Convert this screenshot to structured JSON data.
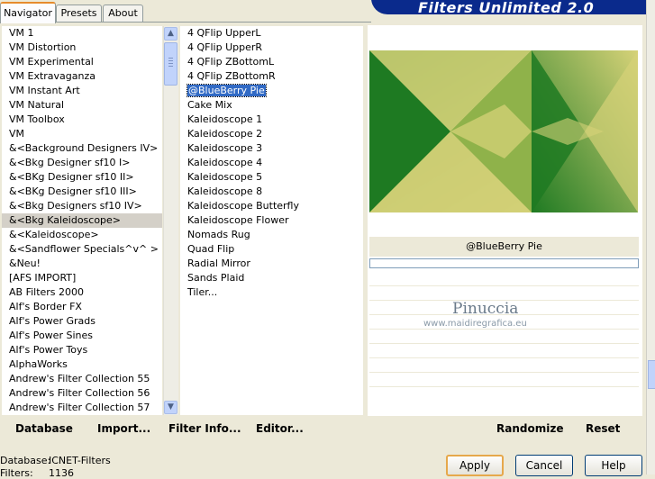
{
  "tabs": [
    {
      "label": "Navigator",
      "active": true
    },
    {
      "label": "Presets",
      "active": false
    },
    {
      "label": "About",
      "active": false
    }
  ],
  "banner": {
    "title": "Filters Unlimited 2.0"
  },
  "categories": {
    "selected_index": 13,
    "items": [
      "VM 1",
      "VM Distortion",
      "VM Experimental",
      "VM Extravaganza",
      "VM Instant Art",
      "VM Natural",
      "VM Toolbox",
      "VM",
      "&<Background Designers IV>",
      "&<Bkg Designer sf10 I>",
      "&<BKg Designer sf10 II>",
      "&<BKg Designer sf10 III>",
      "&<Bkg Designers sf10 IV>",
      "&<Bkg Kaleidoscope>",
      "&<Kaleidoscope>",
      "&<Sandflower Specials^v^ >",
      "&Neu!",
      "[AFS IMPORT]",
      "AB Filters 2000",
      "Alf's Border FX",
      "Alf's Power Grads",
      "Alf's Power Sines",
      "Alf's Power Toys",
      "AlphaWorks",
      "Andrew's Filter Collection 55",
      "Andrew's Filter Collection 56",
      "Andrew's Filter Collection 57"
    ]
  },
  "filters": {
    "selected_index": 4,
    "items": [
      "4 QFlip UpperL",
      "4 QFlip UpperR",
      "4 QFlip ZBottomL",
      "4 QFlip ZBottomR",
      "@BlueBerry Pie",
      "Cake Mix",
      "Kaleidoscope 1",
      "Kaleidoscope 2",
      "Kaleidoscope 3",
      "Kaleidoscope 4",
      "Kaleidoscope 5",
      "Kaleidoscope 8",
      "Kaleidoscope Butterfly",
      "Kaleidoscope Flower",
      "Nomads Rug",
      "Quad Flip",
      "Radial Mirror",
      "Sands Plaid",
      "Tiler..."
    ]
  },
  "preview": {
    "filter_name": "@BlueBerry Pie",
    "watermark_name": "Pinuccia",
    "watermark_url": "www.maidiregrafica.eu",
    "colors": {
      "dark_green": "#1e7a22",
      "light_green": "#d6d278",
      "mid_green": "#8fb24a"
    }
  },
  "toolbar": {
    "database_label": "Database",
    "import_label": "Import...",
    "filter_info_label": "Filter Info...",
    "editor_label": "Editor...",
    "randomize_label": "Randomize",
    "reset_label": "Reset"
  },
  "status": {
    "database_key": "Database:",
    "database_value": "ICNET-Filters",
    "filters_key": "Filters:",
    "filters_value": "1136"
  },
  "dialog": {
    "apply_label": "Apply",
    "cancel_label": "Cancel",
    "help_label": "Help"
  }
}
